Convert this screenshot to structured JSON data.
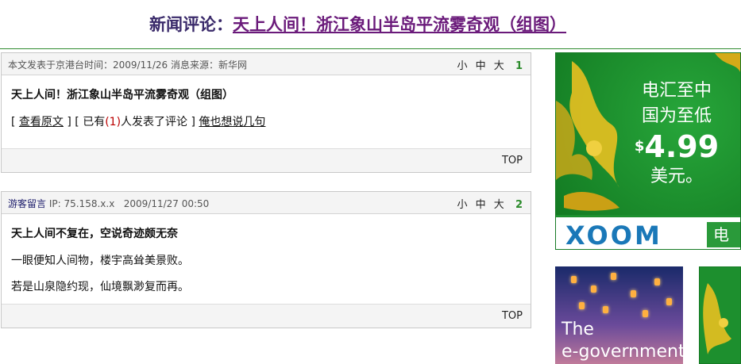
{
  "header": {
    "label": "新闻评论：",
    "title_link": "天上人间！浙江象山半岛平流雾奇观（组图）"
  },
  "posts": [
    {
      "meta": "本文发表于京港台时间：2009/11/26 消息来源：新华网",
      "author": "",
      "ip": "",
      "time": "",
      "sizes": [
        "小",
        "中",
        "大"
      ],
      "floor": "1",
      "title": "天上人间！浙江象山半岛平流雾奇观（组图）",
      "line_parts": {
        "open1": "[ ",
        "view_original": "查看原文",
        "mid": " ] [ 已有",
        "count": "(1)",
        "after_count": "人发表了评论 ] ",
        "comment_link": "俺也想说几句"
      },
      "top": "TOP"
    },
    {
      "author": "游客留言",
      "ip": "IP: 75.158.x.x",
      "time": "2009/11/27 00:50",
      "sizes": [
        "小",
        "中",
        "大"
      ],
      "floor": "2",
      "title": "天上人间不复在，空说奇迹颇无奈",
      "lines": [
        "一眼便知人间物，楼宇高耸美景败。",
        "若是山泉隐约现，仙境飘渺复而再。"
      ],
      "top": "TOP"
    }
  ],
  "ads": {
    "phoenix": {
      "line1": "电汇至中",
      "line2": "国为至低",
      "currency": "$",
      "price": "4.99",
      "line3": "美元。",
      "brand": "XOOM",
      "button_char": "电"
    },
    "lantern": {
      "line1": "The",
      "line2": "e-government"
    }
  },
  "colors": {
    "accent_green": "#2e8b2e",
    "title_link": "#6a1a7a",
    "floor_green": "#2a8a2a",
    "count_red": "#b00000"
  }
}
